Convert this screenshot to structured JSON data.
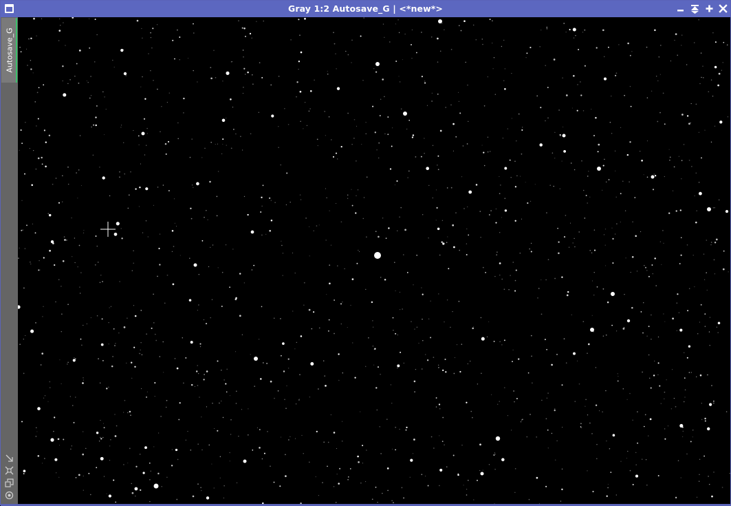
{
  "window": {
    "title": "Gray 1:2 Autosave_G | <*new*>",
    "title_bar_color": "#5c67c0",
    "buttons": [
      {
        "name": "minimize-button",
        "icon": "minimize-icon"
      },
      {
        "name": "shade-button",
        "icon": "shade-icon"
      },
      {
        "name": "maximize-button",
        "icon": "maximize-icon"
      },
      {
        "name": "close-button",
        "icon": "close-icon"
      }
    ]
  },
  "sidebar": {
    "tab_label": "Autosave_G",
    "tab_active_color": "#3bbf6a",
    "icons": [
      "fit-view-icon",
      "zoom-extents-icon",
      "clone-icon",
      "settings-icon"
    ]
  },
  "image": {
    "content": "starfield",
    "background_color": "#000000",
    "star_color": "#ffffff",
    "cursor": "crosshair-icon"
  }
}
